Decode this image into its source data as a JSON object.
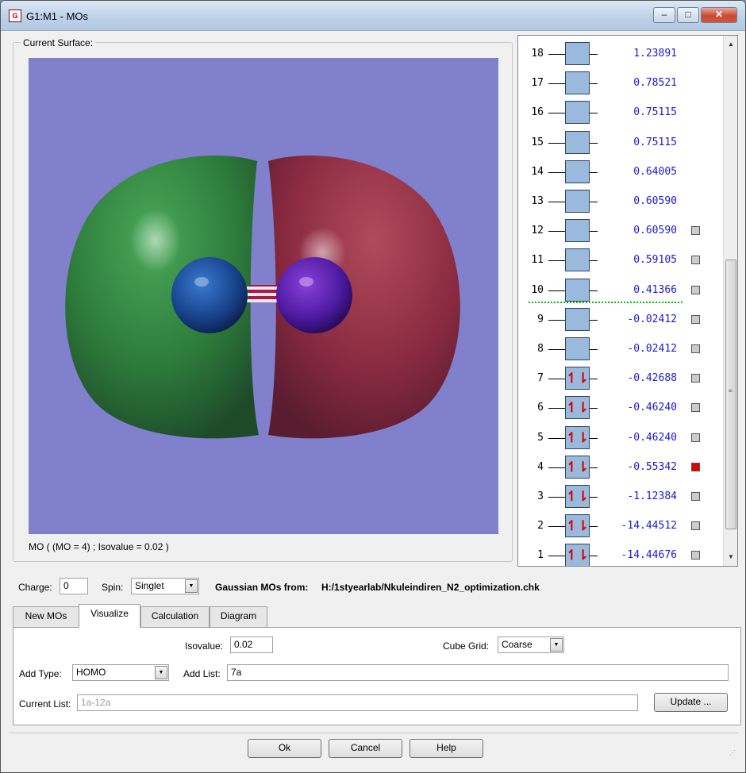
{
  "window": {
    "title": "G1:M1 - MOs",
    "icon": "gaussview-app-icon"
  },
  "surface": {
    "group_label": "Current Surface:",
    "caption": "MO ( (MO = 4) ; Isovalue = 0.02 )",
    "background_color": "#8080cc",
    "positive_lobe_color": "#2e7a3a",
    "negative_lobe_color": "#8a2a40"
  },
  "mo_list": [
    {
      "num": "18",
      "energy": "1.23891",
      "occupied": false,
      "checkbox": false,
      "checked": false
    },
    {
      "num": "17",
      "energy": "0.78521",
      "occupied": false,
      "checkbox": false,
      "checked": false
    },
    {
      "num": "16",
      "energy": "0.75115",
      "occupied": false,
      "checkbox": false,
      "checked": false
    },
    {
      "num": "15",
      "energy": "0.75115",
      "occupied": false,
      "checkbox": false,
      "checked": false
    },
    {
      "num": "14",
      "energy": "0.64005",
      "occupied": false,
      "checkbox": false,
      "checked": false
    },
    {
      "num": "13",
      "energy": "0.60590",
      "occupied": false,
      "checkbox": false,
      "checked": false
    },
    {
      "num": "12",
      "energy": "0.60590",
      "occupied": false,
      "checkbox": true,
      "checked": false
    },
    {
      "num": "11",
      "energy": "0.59105",
      "occupied": false,
      "checkbox": true,
      "checked": false
    },
    {
      "num": "10",
      "energy": "0.41366",
      "occupied": false,
      "checkbox": true,
      "checked": false
    },
    {
      "num": "9",
      "energy": "-0.02412",
      "occupied": false,
      "checkbox": true,
      "checked": false
    },
    {
      "num": "8",
      "energy": "-0.02412",
      "occupied": false,
      "checkbox": true,
      "checked": false
    },
    {
      "num": "7",
      "energy": "-0.42688",
      "occupied": true,
      "checkbox": true,
      "checked": false
    },
    {
      "num": "6",
      "energy": "-0.46240",
      "occupied": true,
      "checkbox": true,
      "checked": false
    },
    {
      "num": "5",
      "energy": "-0.46240",
      "occupied": true,
      "checkbox": true,
      "checked": false
    },
    {
      "num": "4",
      "energy": "-0.55342",
      "occupied": true,
      "checkbox": true,
      "checked": true
    },
    {
      "num": "3",
      "energy": "-1.12384",
      "occupied": true,
      "checkbox": true,
      "checked": false
    },
    {
      "num": "2",
      "energy": "-14.44512",
      "occupied": true,
      "checkbox": true,
      "checked": false
    },
    {
      "num": "1",
      "energy": "-14.44676",
      "occupied": true,
      "checkbox": true,
      "checked": false
    }
  ],
  "occupied_symbol": "↿⇂",
  "charge": {
    "label": "Charge:",
    "value": "0"
  },
  "spin": {
    "label": "Spin:",
    "value": "Singlet"
  },
  "source": {
    "label": "Gaussian MOs from:",
    "path": "H:/1styearlab/Nkuleindiren_N2_optimization.chk"
  },
  "tabs": [
    "New MOs",
    "Visualize",
    "Calculation",
    "Diagram"
  ],
  "active_tab": "Visualize",
  "visualize": {
    "isovalue_label": "Isovalue:",
    "isovalue": "0.02",
    "cube_grid_label": "Cube Grid:",
    "cube_grid": "Coarse",
    "add_type_label": "Add Type:",
    "add_type": "HOMO",
    "add_list_label": "Add List:",
    "add_list": "7a",
    "current_list_label": "Current List:",
    "current_list": "1a-12a",
    "update_label": "Update ..."
  },
  "buttons": {
    "ok": "Ok",
    "cancel": "Cancel",
    "help": "Help"
  }
}
